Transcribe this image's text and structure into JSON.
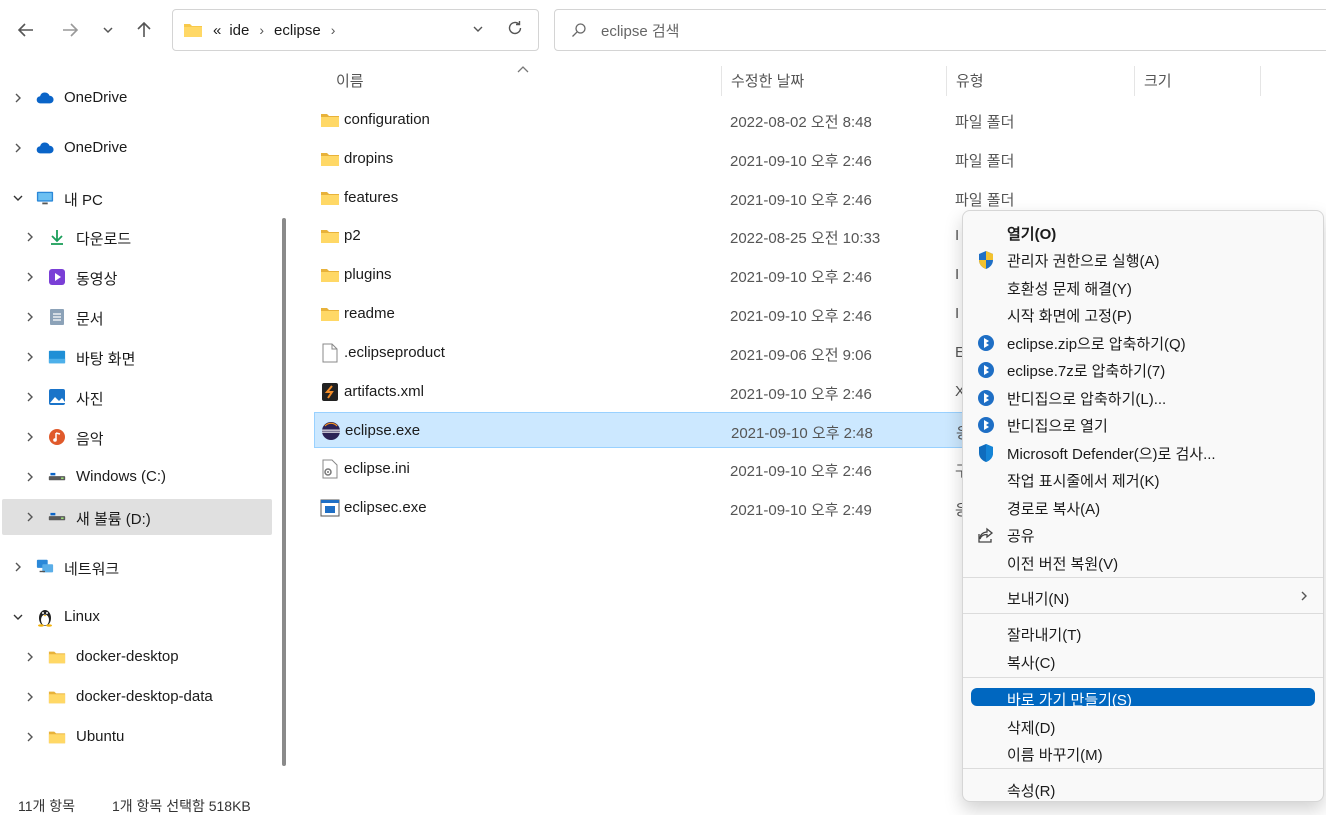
{
  "toolbar": {
    "breadcrumb": {
      "overflow": "«",
      "items": [
        "ide",
        "eclipse"
      ],
      "separator": "›"
    },
    "search_placeholder": "eclipse 검색"
  },
  "sidebar": {
    "items": [
      {
        "label": "OneDrive",
        "icon": "cloud-icon",
        "expanded": false
      },
      {
        "label": "OneDrive",
        "icon": "cloud-icon",
        "expanded": false
      },
      {
        "label": "내 PC",
        "icon": "pc-icon",
        "expanded": true
      },
      {
        "label": "다운로드",
        "icon": "download-icon",
        "expanded": false
      },
      {
        "label": "동영상",
        "icon": "video-icon",
        "expanded": false
      },
      {
        "label": "문서",
        "icon": "document-icon",
        "expanded": false
      },
      {
        "label": "바탕 화면",
        "icon": "desktop-icon",
        "expanded": false
      },
      {
        "label": "사진",
        "icon": "pictures-icon",
        "expanded": false
      },
      {
        "label": "음악",
        "icon": "music-icon",
        "expanded": false
      },
      {
        "label": "Windows (C:)",
        "icon": "drive-icon",
        "expanded": false
      },
      {
        "label": "새 볼륨 (D:)",
        "icon": "drive-icon",
        "expanded": false,
        "selected": true
      },
      {
        "label": "네트워크",
        "icon": "network-icon",
        "expanded": false
      },
      {
        "label": "Linux",
        "icon": "linux-icon",
        "expanded": true
      },
      {
        "label": "docker-desktop",
        "icon": "folder-icon",
        "expanded": false
      },
      {
        "label": "docker-desktop-data",
        "icon": "folder-icon",
        "expanded": false
      },
      {
        "label": "Ubuntu",
        "icon": "folder-icon",
        "expanded": false
      }
    ]
  },
  "status": {
    "count": "11개 항목",
    "selection": "1개 항목 선택함 518KB"
  },
  "columns": {
    "name": "이름",
    "date": "수정한 날짜",
    "type": "유형",
    "size": "크기"
  },
  "files": [
    {
      "name": "configuration",
      "date": "2022-08-02 오전 8:48",
      "type": "파일 폴더",
      "icon": "folder-icon"
    },
    {
      "name": "dropins",
      "date": "2021-09-10 오후 2:46",
      "type": "파일 폴더",
      "icon": "folder-icon"
    },
    {
      "name": "features",
      "date": "2021-09-10 오후 2:46",
      "type": "파일 폴더",
      "icon": "folder-icon"
    },
    {
      "name": "p2",
      "date": "2022-08-25 오전 10:33",
      "type": "I",
      "icon": "folder-icon"
    },
    {
      "name": "plugins",
      "date": "2021-09-10 오후 2:46",
      "type": "I",
      "icon": "folder-icon"
    },
    {
      "name": "readme",
      "date": "2021-09-10 오후 2:46",
      "type": "I",
      "icon": "folder-icon"
    },
    {
      "name": ".eclipseproduct",
      "date": "2021-09-06 오전 9:06",
      "type": "E",
      "icon": "file-icon"
    },
    {
      "name": "artifacts.xml",
      "date": "2021-09-10 오후 2:46",
      "type": "X",
      "icon": "xml-icon"
    },
    {
      "name": "eclipse.exe",
      "date": "2021-09-10 오후 2:48",
      "type": "응",
      "icon": "eclipse-icon",
      "selected": true
    },
    {
      "name": "eclipse.ini",
      "date": "2021-09-10 오후 2:46",
      "type": "구",
      "icon": "ini-icon"
    },
    {
      "name": "eclipsec.exe",
      "date": "2021-09-10 오후 2:49",
      "type": "응",
      "icon": "exe-icon"
    }
  ],
  "context_menu": {
    "items": [
      {
        "label": "열기(O)",
        "icon": "",
        "bold": true
      },
      {
        "label": "관리자 권한으로 실행(A)",
        "icon": "shield-icon"
      },
      {
        "label": "호환성 문제 해결(Y)",
        "icon": ""
      },
      {
        "label": "시작 화면에 고정(P)",
        "icon": ""
      },
      {
        "label": "eclipse.zip으로 압축하기(Q)",
        "icon": "bandizip-icon"
      },
      {
        "label": "eclipse.7z로 압축하기(7)",
        "icon": "bandizip-icon"
      },
      {
        "label": "반디집으로 압축하기(L)...",
        "icon": "bandizip-icon"
      },
      {
        "label": "반디집으로 열기",
        "icon": "bandizip-icon"
      },
      {
        "label": "Microsoft Defender(으)로 검사...",
        "icon": "defender-icon"
      },
      {
        "label": "작업 표시줄에서 제거(K)",
        "icon": ""
      },
      {
        "label": "경로로 복사(A)",
        "icon": ""
      },
      {
        "label": "공유",
        "icon": "share-icon"
      },
      {
        "label": "이전 버전 복원(V)",
        "icon": ""
      },
      {
        "label": "보내기(N)",
        "icon": "",
        "submenu": true
      },
      {
        "label": "잘라내기(T)",
        "icon": ""
      },
      {
        "label": "복사(C)",
        "icon": ""
      },
      {
        "label": "바로 가기 만들기(S)",
        "icon": "",
        "highlighted": true
      },
      {
        "label": "삭제(D)",
        "icon": ""
      },
      {
        "label": "이름 바꾸기(M)",
        "icon": ""
      },
      {
        "label": "속성(R)",
        "icon": ""
      }
    ]
  },
  "colors": {
    "selection_bg": "#cce8ff",
    "menu_highlight": "#0067c0",
    "folder": "#f8c94a"
  }
}
